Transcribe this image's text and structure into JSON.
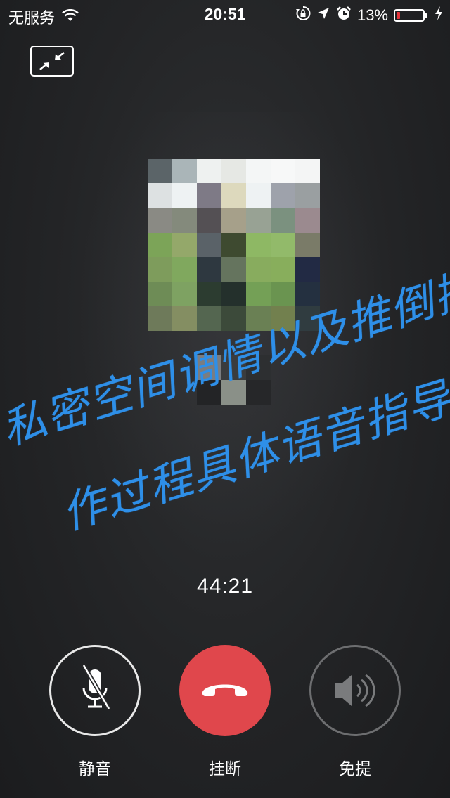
{
  "status_bar": {
    "carrier": "无服务",
    "time": "20:51",
    "battery_percent": "13%",
    "battery_level": 0.13,
    "icons": [
      "wifi-icon",
      "orientation-lock-icon",
      "location-icon",
      "alarm-icon",
      "battery-icon",
      "charging-icon"
    ]
  },
  "call": {
    "timer": "44:21",
    "minimize_icon": "minimize-icon"
  },
  "watermark": {
    "line1": "私密空间调情以及推倒操",
    "line2": "作过程具体语音指导",
    "color": "#2e8fe8"
  },
  "controls": {
    "mute_label": "静音",
    "hangup_label": "挂断",
    "speaker_label": "免提",
    "hangup_color": "#e0474c"
  },
  "avatar": {
    "description_icon": "pixelated-avatar",
    "colors": [
      [
        "#5b6468",
        "#aab5b8",
        "#eef1f0",
        "#e6e8e4",
        "#f4f6f6",
        "#f7f8f8",
        "#f4f5f5"
      ],
      [
        "#dde1e2",
        "#eef2f3",
        "#7e7a86",
        "#ddd9bd",
        "#eef2f3",
        "#9ea2ab",
        "#9a9fa1"
      ],
      [
        "#8a8a84",
        "#848a7c",
        "#545054",
        "#a6a08a",
        "#98a294",
        "#7b917f",
        "#9b8a8f"
      ],
      [
        "#7ca458",
        "#94a86a",
        "#5a6268",
        "#3e4a30",
        "#8eb864",
        "#92ba6a",
        "#7a7b68"
      ],
      [
        "#7e9c5c",
        "#80a85e",
        "#2e3840",
        "#65745e",
        "#88ac5e",
        "#88ae5c",
        "#222a44"
      ],
      [
        "#6e8c56",
        "#7ea262",
        "#2c3c30",
        "#24302c",
        "#74a056",
        "#6a9450",
        "#243040"
      ],
      [
        "#6e7a5a",
        "#848e62",
        "#546650",
        "#3c4a3a",
        "#6a8054",
        "#72804e",
        "#303c40"
      ]
    ],
    "tail_colors": [
      [
        "#7b7d80",
        "#3a3c3e",
        "#2d2f31"
      ],
      [
        "#232426",
        "#8a9088",
        "#262729"
      ]
    ]
  }
}
